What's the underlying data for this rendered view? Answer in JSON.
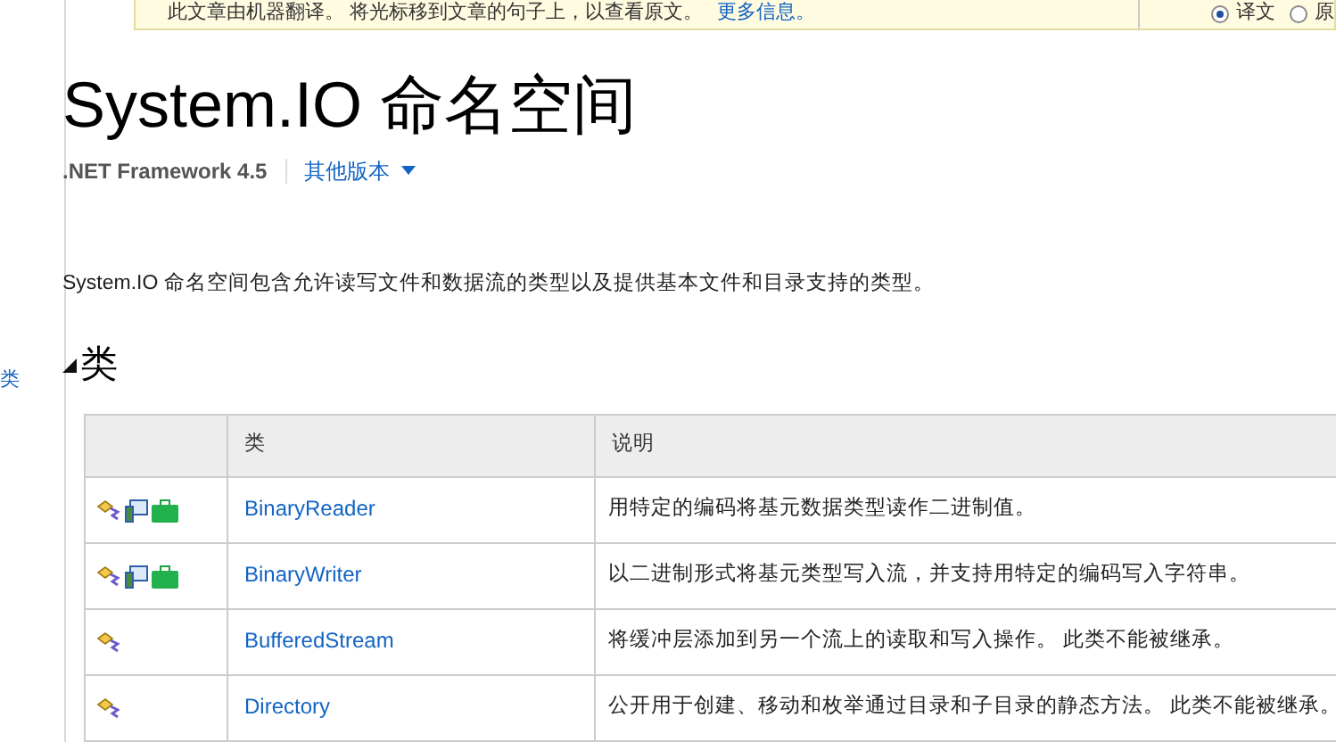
{
  "sidebar": {
    "items": [
      {
        "label": "类",
        "selected": false
      }
    ]
  },
  "banner": {
    "text": "此文章由机器翻译。 将光标移到文章的句子上，以查看原文。",
    "link": "更多信息。",
    "options": [
      {
        "label": "译文",
        "selected": true
      },
      {
        "label": "原",
        "selected": false
      }
    ]
  },
  "title": "System.IO 命名空间",
  "version": ".NET Framework 4.5",
  "other_versions": "其他版本",
  "description": "System.IO 命名空间包含允许读写文件和数据流的类型以及提供基本文件和目录支持的类型。",
  "section": {
    "heading": "类",
    "expanded": true
  },
  "table": {
    "columns": [
      "类",
      "说明"
    ],
    "rows": [
      {
        "name": "BinaryReader",
        "description": "用特定的编码将基元数据类型读作二进制值。",
        "screen_icon": true,
        "bag_icon": true
      },
      {
        "name": "BinaryWriter",
        "description": "以二进制形式将基元类型写入流，并支持用特定的编码写入字符串。",
        "screen_icon": true,
        "bag_icon": true
      },
      {
        "name": "BufferedStream",
        "description": "将缓冲层添加到另一个流上的读取和写入操作。 此类不能被继承。",
        "screen_icon": false,
        "bag_icon": false
      },
      {
        "name": "Directory",
        "description": "公开用于创建、移动和枚举通过目录和子目录的静态方法。 此类不能被继承。",
        "screen_icon": false,
        "bag_icon": false
      }
    ]
  }
}
